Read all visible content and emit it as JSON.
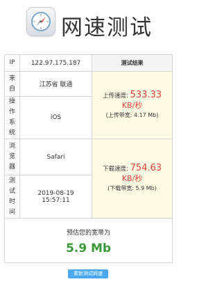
{
  "app": {
    "title": "网速测试",
    "icon": "compass-icon"
  },
  "table": {
    "ip_label": "IP",
    "ip_value": "122.97.175.187",
    "result_header": "测试结果",
    "from_label": "来自",
    "from_value": "江苏省 联通",
    "os_label": "操作系统",
    "os_value": "iOS",
    "browser_label": "浏览器",
    "browser_value": "Safari",
    "time_label": "测试时间",
    "time_date": "2019-08-19",
    "time_clock": "15:57:11",
    "upload_label": "上传速度:",
    "upload_value": "533.33",
    "upload_unit": "KB/秒",
    "upload_band": "(上传带宽: 4.17 Mb)",
    "download_label": "下载速度:",
    "download_value": "754.63",
    "download_unit": "KB/秒",
    "download_band": "(下载带宽: 5.9 Mb)",
    "estimate_label": "预估您的宽带为",
    "estimate_value": "5.9 Mb"
  },
  "actions": {
    "retest_label": "重新测试网速"
  },
  "colors": {
    "speed": "#e2423e",
    "estimate": "#3a9a3a",
    "button": "#4aa8f0",
    "result_bg": "#fdfbe3"
  }
}
